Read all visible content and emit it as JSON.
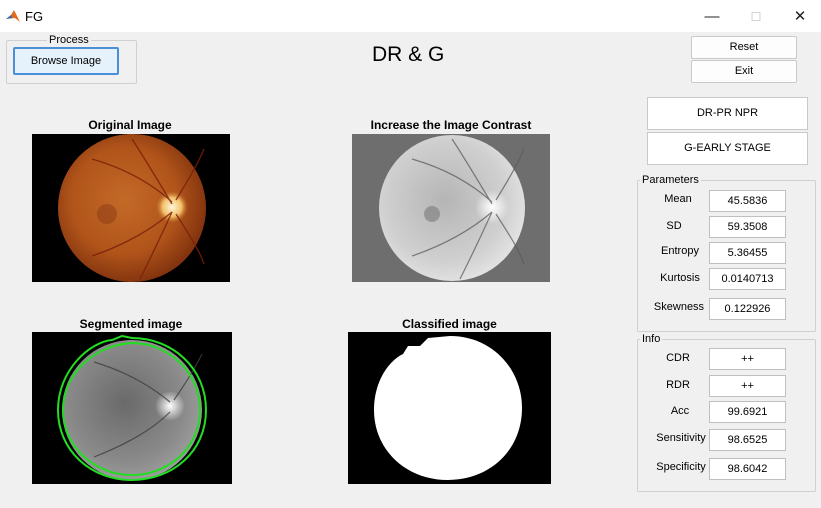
{
  "window": {
    "title": "FG",
    "minimize_glyph": "—",
    "maximize_glyph": "☐",
    "close_glyph": "✕"
  },
  "process_panel": {
    "legend": "Process",
    "browse_label": "Browse Image"
  },
  "app_title": "DR & G",
  "controls": {
    "reset_label": "Reset",
    "exit_label": "Exit"
  },
  "images": {
    "original_title": "Original Image",
    "contrast_title": "Increase the Image Contrast",
    "segmented_title": "Segmented image",
    "classified_title": "Classified image"
  },
  "results": {
    "dr_result": "DR-PR NPR",
    "g_result": "G-EARLY STAGE"
  },
  "parameters": {
    "legend": "Parameters",
    "items": [
      {
        "label": "Mean",
        "value": "45.5836"
      },
      {
        "label": "SD",
        "value": "59.3508"
      },
      {
        "label": "Entropy",
        "value": "5.36455"
      },
      {
        "label": "Kurtosis",
        "value": "0.0140713"
      },
      {
        "label": "Skewness",
        "value": "0.122926"
      }
    ]
  },
  "info": {
    "legend": "Info",
    "items": [
      {
        "label": "CDR",
        "value": "++"
      },
      {
        "label": "RDR",
        "value": "++"
      },
      {
        "label": "Acc",
        "value": "99.6921"
      },
      {
        "label": "Sensitivity",
        "value": "98.6525"
      },
      {
        "label": "Specificity",
        "value": "98.6042"
      }
    ]
  },
  "colors": {
    "segment_outline": "#22dd22",
    "browse_border": "#4a8fd8"
  },
  "icons": {
    "app": "matlab-icon"
  }
}
